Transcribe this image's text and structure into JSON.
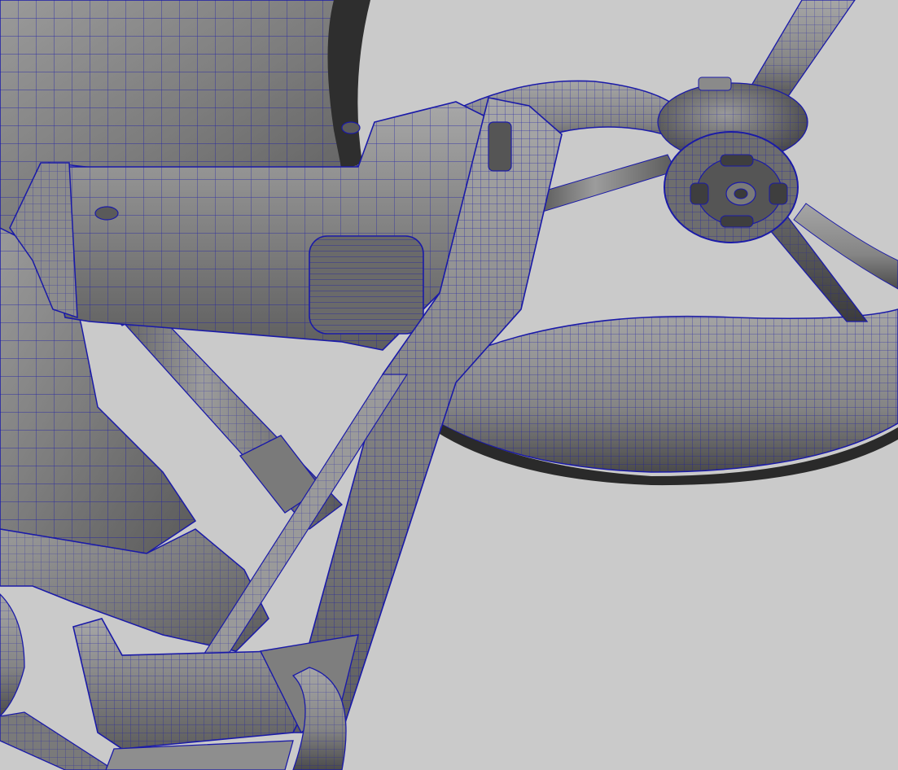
{
  "viewport": {
    "background_color": "#cacaca",
    "wireframe_color": "#1a1aa8",
    "shaded_surface_color": "#7a7a7a",
    "shadow_color": "#3a3a3a",
    "highlight_color": "#b4b4b4",
    "mode": "wireframe-on-shaded"
  }
}
